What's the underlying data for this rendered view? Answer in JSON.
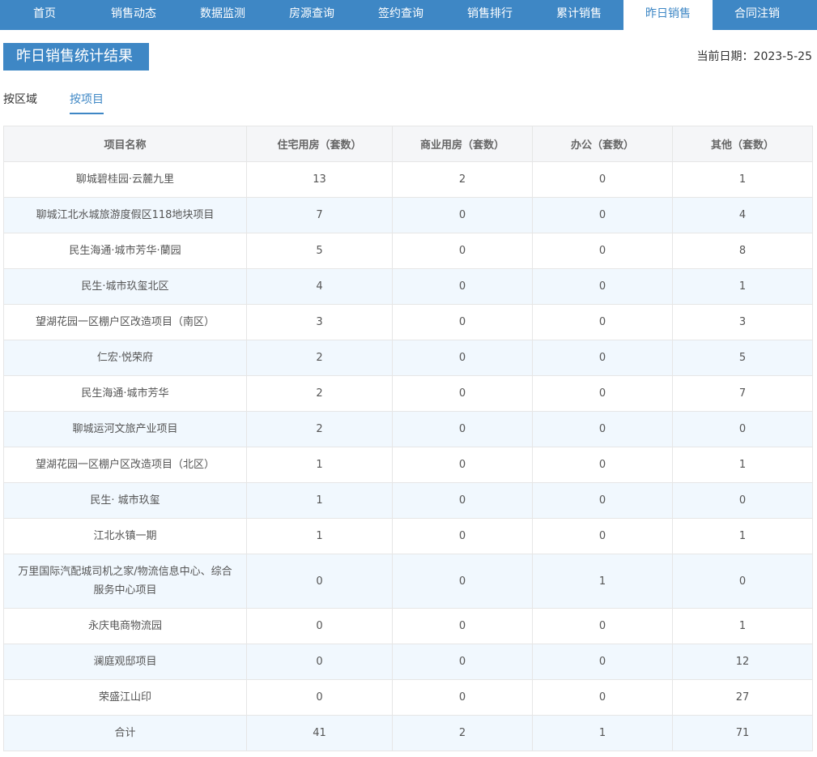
{
  "nav": {
    "items": [
      {
        "label": "首页"
      },
      {
        "label": "销售动态"
      },
      {
        "label": "数据监测"
      },
      {
        "label": "房源查询"
      },
      {
        "label": "签约查询"
      },
      {
        "label": "销售排行"
      },
      {
        "label": "累计销售"
      },
      {
        "label": "昨日销售",
        "active": true
      },
      {
        "label": "合同注销"
      }
    ],
    "active_color": "#3e87c5"
  },
  "page": {
    "title": "昨日销售统计结果",
    "date_label": "当前日期：",
    "date_value": "2023-5-25"
  },
  "subtabs": [
    {
      "label": "按区域"
    },
    {
      "label": "按项目",
      "active": true
    }
  ],
  "table": {
    "headers": [
      "项目名称",
      "住宅用房（套数）",
      "商业用房（套数）",
      "办公（套数）",
      "其他（套数）"
    ],
    "rows": [
      [
        "聊城碧桂园·云麓九里",
        "13",
        "2",
        "0",
        "1"
      ],
      [
        "聊城江北水城旅游度假区118地块项目",
        "7",
        "0",
        "0",
        "4"
      ],
      [
        "民生海通·城市芳华·蘭园",
        "5",
        "0",
        "0",
        "8"
      ],
      [
        "民生·城市玖玺北区",
        "4",
        "0",
        "0",
        "1"
      ],
      [
        "望湖花园一区棚户区改造项目（南区）",
        "3",
        "0",
        "0",
        "3"
      ],
      [
        "仁宏·悦荣府",
        "2",
        "0",
        "0",
        "5"
      ],
      [
        "民生海通·城市芳华",
        "2",
        "0",
        "0",
        "7"
      ],
      [
        "聊城运河文旅产业项目",
        "2",
        "0",
        "0",
        "0"
      ],
      [
        "望湖花园一区棚户区改造项目（北区）",
        "1",
        "0",
        "0",
        "1"
      ],
      [
        "民生· 城市玖玺",
        "1",
        "0",
        "0",
        "0"
      ],
      [
        "江北水镇一期",
        "1",
        "0",
        "0",
        "1"
      ],
      [
        "万里国际汽配城司机之家/物流信息中心、综合服务中心项目",
        "0",
        "0",
        "1",
        "0"
      ],
      [
        "永庆电商物流园",
        "0",
        "0",
        "0",
        "1"
      ],
      [
        "澜庭观邸项目",
        "0",
        "0",
        "0",
        "12"
      ],
      [
        "荣盛江山印",
        "0",
        "0",
        "0",
        "27"
      ],
      [
        "合计",
        "41",
        "2",
        "1",
        "71"
      ]
    ]
  }
}
